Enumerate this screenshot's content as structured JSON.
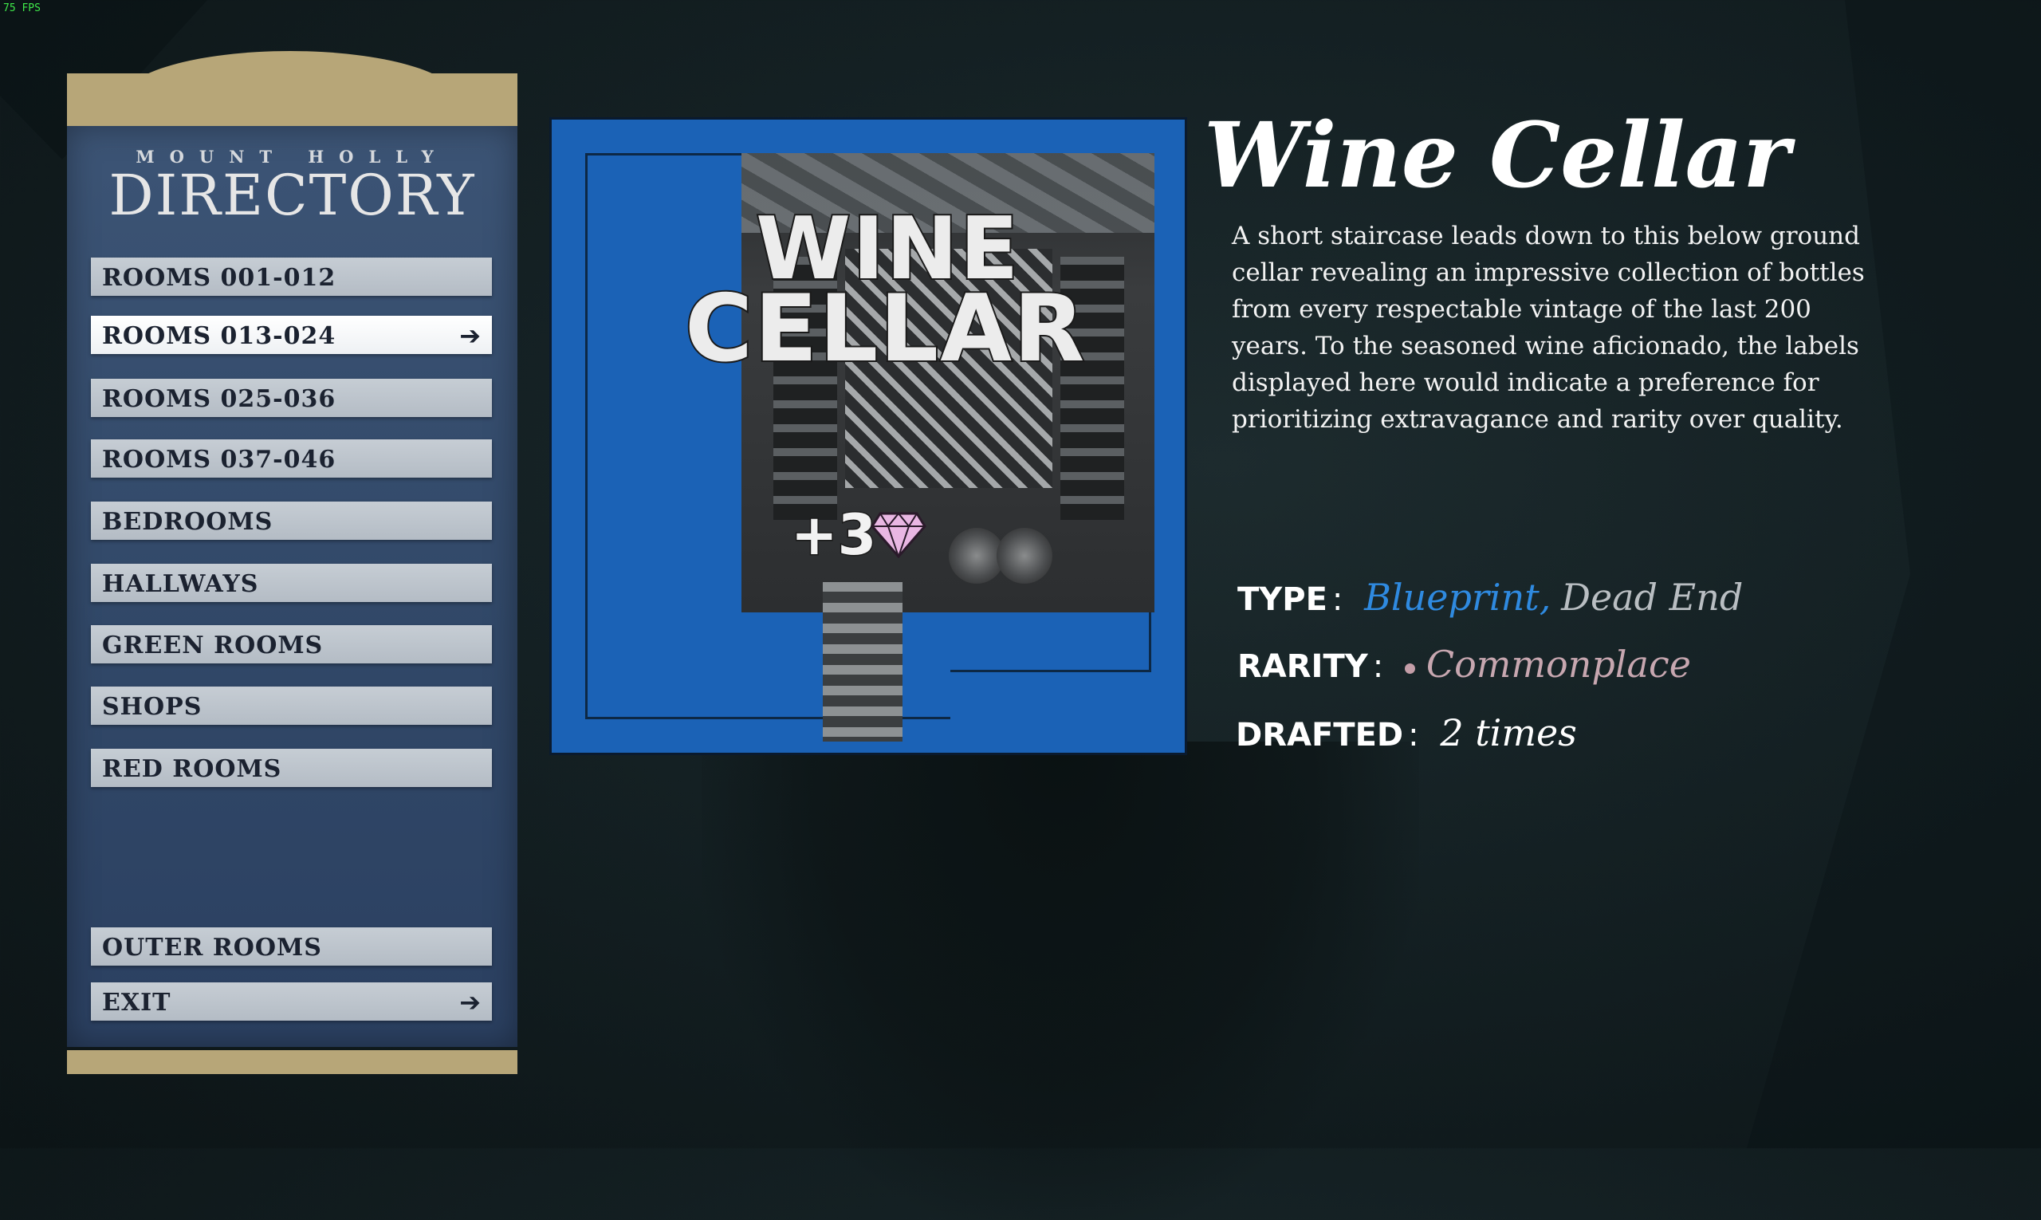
{
  "hud": {
    "fps": "75 FPS"
  },
  "directory": {
    "subtitle": "MOUNT HOLLY",
    "title": "DIRECTORY",
    "items": [
      {
        "label": "ROOMS 001-012",
        "selected": false,
        "arrow": ""
      },
      {
        "label": "ROOMS 013-024",
        "selected": true,
        "arrow": "➔"
      },
      {
        "label": "ROOMS 025-036",
        "selected": false,
        "arrow": ""
      },
      {
        "label": "ROOMS 037-046",
        "selected": false,
        "arrow": ""
      },
      {
        "label": "BEDROOMS",
        "selected": false,
        "arrow": ""
      },
      {
        "label": "HALLWAYS",
        "selected": false,
        "arrow": ""
      },
      {
        "label": "GREEN ROOMS",
        "selected": false,
        "arrow": ""
      },
      {
        "label": "SHOPS",
        "selected": false,
        "arrow": ""
      },
      {
        "label": "RED ROOMS",
        "selected": false,
        "arrow": ""
      },
      {
        "label": "OUTER ROOMS",
        "selected": false,
        "arrow": ""
      },
      {
        "label": "EXIT",
        "selected": false,
        "arrow": "➔"
      }
    ]
  },
  "room_card": {
    "name_line1": "WINE",
    "name_line2": "CELLAR",
    "gem_bonus": "+3",
    "gem_icon": "gem-icon",
    "card_color": "#1b62b6"
  },
  "room_info": {
    "title": "Wine Cellar",
    "description": "A short staircase leads down to this below ground cellar revealing an impressive collection of bottles from every respectable vintage of the last 200 years. To the seasoned wine aficionado, the labels displayed here would indicate a preference for prioritizing extravagance and rarity over quality.",
    "type_label": "TYPE",
    "type_value_1": "Blueprint,",
    "type_value_2": "Dead End",
    "rarity_label": "RARITY",
    "rarity_value": "Commonplace",
    "drafted_label": "DRAFTED",
    "drafted_value": "2 times"
  }
}
